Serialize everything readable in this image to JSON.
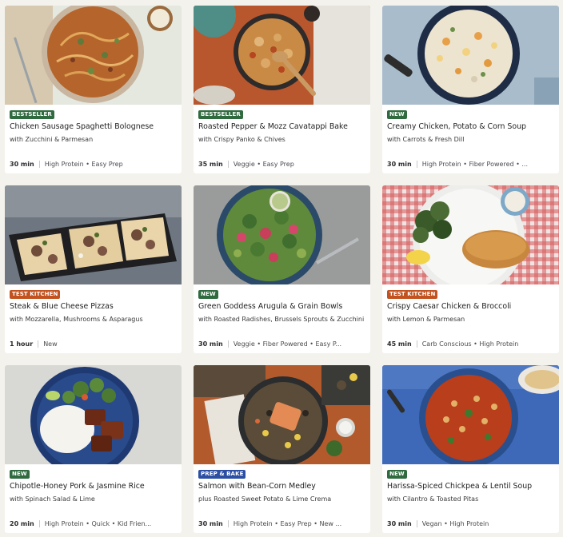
{
  "colors": {
    "badge_bestseller": "#2f6b3f",
    "badge_new": "#2f6b3f",
    "badge_test_kitchen": "#c2521f",
    "badge_prep_bake": "#2c4fa3"
  },
  "recipes": [
    {
      "badge": "BESTSELLER",
      "badge_color": "#2f6b3f",
      "title": "Chicken Sausage Spaghetti Bolognese",
      "subtitle": "with Zucchini & Parmesan",
      "time": "30 min",
      "tags": "High Protein • Easy Prep",
      "photo": "spaghetti-bolognese-photo"
    },
    {
      "badge": "BESTSELLER",
      "badge_color": "#2f6b3f",
      "title": "Roasted Pepper & Mozz Cavatappi Bake",
      "subtitle": "with Crispy Panko & Chives",
      "time": "35 min",
      "tags": "Veggie • Easy Prep",
      "photo": "cavatappi-bake-photo"
    },
    {
      "badge": "NEW",
      "badge_color": "#2f6b3f",
      "title": "Creamy Chicken, Potato & Corn Soup",
      "subtitle": "with Carrots & Fresh Dill",
      "time": "30 min",
      "tags": "High Protein • Fiber Powered • ...",
      "photo": "corn-soup-photo"
    },
    {
      "badge": "TEST KITCHEN",
      "badge_color": "#c2521f",
      "title": "Steak & Blue Cheese Pizzas",
      "subtitle": "with Mozzarella, Mushrooms & Asparagus",
      "time": "1 hour",
      "tags": "New",
      "photo": "steak-pizza-photo"
    },
    {
      "badge": "NEW",
      "badge_color": "#2f6b3f",
      "title": "Green Goddess Arugula & Grain Bowls",
      "subtitle": "with Roasted Radishes, Brussels Sprouts & Zucchini",
      "time": "30 min",
      "tags": "Veggie • Fiber Powered • Easy P...",
      "photo": "grain-bowl-photo"
    },
    {
      "badge": "TEST KITCHEN",
      "badge_color": "#c2521f",
      "title": "Crispy Caesar Chicken & Broccoli",
      "subtitle": "with Lemon & Parmesan",
      "time": "45 min",
      "tags": "Carb Conscious • High Protein",
      "photo": "caesar-chicken-photo"
    },
    {
      "badge": "NEW",
      "badge_color": "#2f6b3f",
      "title": "Chipotle-Honey Pork & Jasmine Rice",
      "subtitle": "with Spinach Salad & Lime",
      "time": "20 min",
      "tags": "High Protein • Quick • Kid Frien...",
      "photo": "pork-rice-photo"
    },
    {
      "badge": "PREP & BAKE",
      "badge_color": "#2c4fa3",
      "title": "Salmon with Bean-Corn Medley",
      "subtitle": "plus Roasted Sweet Potato & Lime Crema",
      "time": "30 min",
      "tags": "High Protein • Easy Prep • New ...",
      "photo": "salmon-medley-photo"
    },
    {
      "badge": "NEW",
      "badge_color": "#2f6b3f",
      "title": "Harissa-Spiced Chickpea & Lentil Soup",
      "subtitle": "with Cilantro & Toasted Pitas",
      "time": "30 min",
      "tags": "Vegan • High Protein",
      "photo": "lentil-soup-photo"
    }
  ]
}
